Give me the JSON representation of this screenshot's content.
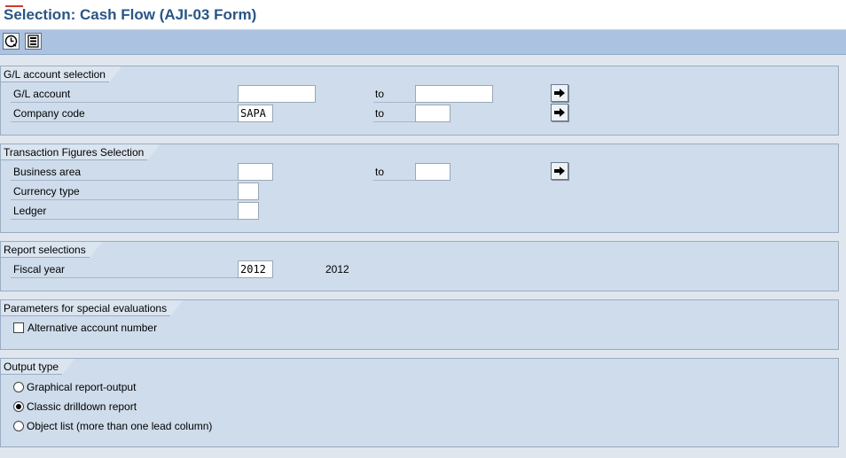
{
  "window": {
    "title": "Selection: Cash Flow (AJI-03 Form)"
  },
  "toolbar": {
    "execute_icon": "execute-clock-icon",
    "selection_icon": "selection-list-icon"
  },
  "gl_account_section": {
    "header": "G/L account selection",
    "gl_account": {
      "label": "G/L account",
      "from_value": "",
      "to_label": "to",
      "to_value": ""
    },
    "company_code": {
      "label": "Company code",
      "from_value": "SAPA",
      "to_label": "to",
      "to_value": ""
    }
  },
  "transaction_section": {
    "header": "Transaction Figures Selection",
    "business_area": {
      "label": "Business area",
      "from_value": "",
      "to_label": "to",
      "to_value": ""
    },
    "currency_type": {
      "label": "Currency type",
      "value": ""
    },
    "ledger": {
      "label": "Ledger",
      "value": ""
    }
  },
  "report_section": {
    "header": "Report selections",
    "fiscal_year": {
      "label": "Fiscal year",
      "value": "2012",
      "display": "2012"
    }
  },
  "special_section": {
    "header": "Parameters for special evaluations",
    "alt_account": {
      "label": "Alternative account number",
      "checked": false
    }
  },
  "output_section": {
    "header": "Output type",
    "options": [
      {
        "label": "Graphical report-output",
        "selected": false
      },
      {
        "label": "Classic drilldown report",
        "selected": true
      },
      {
        "label": "Object list (more than one lead column)",
        "selected": false
      }
    ]
  },
  "colors": {
    "title": "#2a5586",
    "toolbar": "#abc3e0",
    "panel": "#cfdceb",
    "background": "#dfe6ee"
  }
}
